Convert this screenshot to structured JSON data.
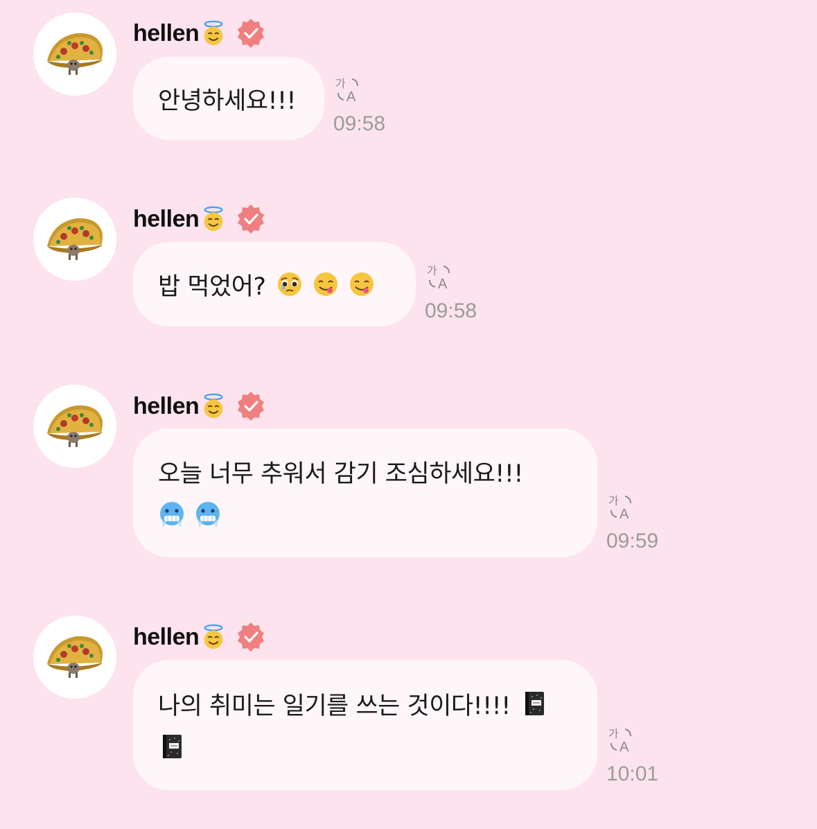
{
  "messages": [
    {
      "sender": "hellen",
      "time": "09:58",
      "lines": [
        "안녕하세요!!!"
      ],
      "emojis": [
        []
      ]
    },
    {
      "sender": "hellen",
      "time": "09:58",
      "lines": [
        "밥 먹었어?"
      ],
      "emojis": [
        [
          "pleading-face",
          "yum-face",
          "yum-face"
        ]
      ]
    },
    {
      "sender": "hellen",
      "time": "09:59",
      "lines": [
        "오늘 너무 추워서 감기 조심하세요!!!",
        ""
      ],
      "emojis": [
        [],
        [
          "cold-face",
          "cold-face"
        ]
      ]
    },
    {
      "sender": "hellen",
      "time": "10:01",
      "lines": [
        "나의 취미는 일기를 쓰는 것이다!!!!",
        ""
      ],
      "emojis": [
        [
          "notebook"
        ],
        [
          "notebook"
        ]
      ]
    }
  ],
  "colors": {
    "background": "#fde3ee",
    "bubble": "#fff6f9",
    "verified": "#f07f7f",
    "timestamp": "#9b9b9b"
  },
  "icons": {
    "avatar": "taco-icon",
    "verified": "verified-badge-icon",
    "translate": "translate-icon"
  }
}
